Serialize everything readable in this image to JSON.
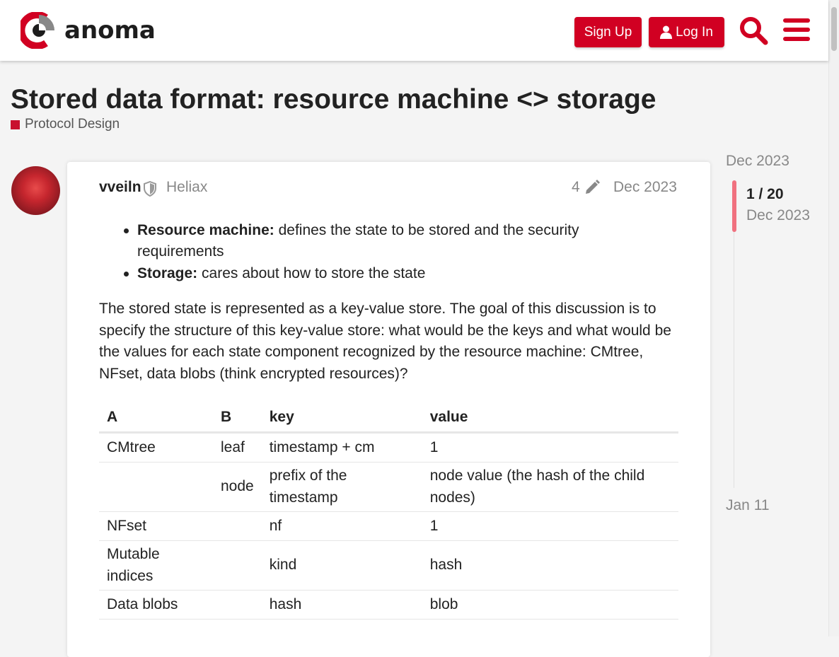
{
  "header": {
    "logo_text": "anoma",
    "signup_label": "Sign Up",
    "login_label": "Log In",
    "search_icon": "search-icon",
    "menu_icon": "hamburger-menu-icon",
    "accent_color": "#d10022"
  },
  "topic": {
    "title": "Stored data format: resource machine <> storage",
    "category": "Protocol Design",
    "category_color": "#c8102e"
  },
  "post": {
    "username": "vveiln",
    "user_title": "Heliax",
    "edit_count": "4",
    "date": "Dec 2023",
    "bullets": [
      {
        "bold": "Resource machine:",
        "text": " defines the state to be stored and the security requirements"
      },
      {
        "bold": "Storage:",
        "text": " cares about how to store the state"
      }
    ],
    "paragraph": "The stored state is represented as a key-value store. The goal of this discussion is to specify the structure of this key-value store: what would be the keys and what would be the values for each state component recognized by the resource machine: CMtree, NFset, data blobs (think encrypted resources)?",
    "table": {
      "headers": [
        "A",
        "B",
        "key",
        "value"
      ],
      "rows": [
        [
          "CMtree",
          "leaf",
          "timestamp + cm",
          "1"
        ],
        [
          "",
          "node",
          "prefix of the timestamp",
          "node value (the hash of the child nodes)"
        ],
        [
          "NFset",
          "",
          "nf",
          "1"
        ],
        [
          "Mutable indices",
          "",
          "kind",
          "hash"
        ],
        [
          "Data blobs",
          "",
          "hash",
          "blob"
        ]
      ]
    }
  },
  "timeline": {
    "start_date": "Dec 2023",
    "position": "1 / 20",
    "current_date": "Dec 2023",
    "end_date": "Jan 11"
  }
}
